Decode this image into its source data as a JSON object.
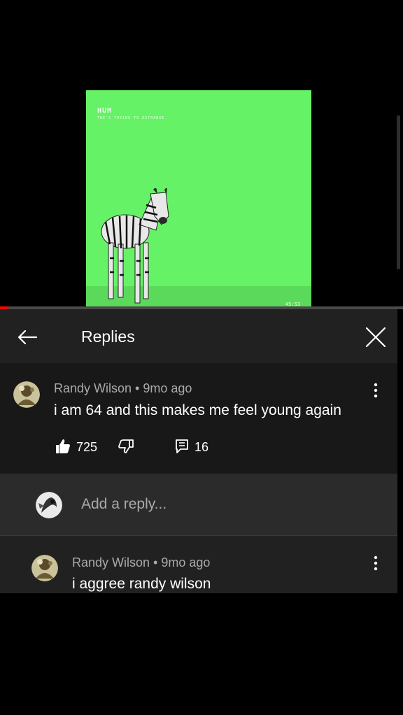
{
  "video": {
    "title": "HUM",
    "subtitle": "THE'S TRYING TO ESTRANGE",
    "timestamp": "45:53",
    "progress_fraction": 0.02
  },
  "replies_panel": {
    "title": "Replies",
    "back_icon": "arrow-left-icon",
    "close_icon": "close-icon"
  },
  "comment": {
    "author": "Randy Wilson",
    "separator": "•",
    "age": "9mo ago",
    "meta": "Randy Wilson • 9mo ago",
    "text": "i am 64 and this makes me feel young again",
    "likes": "725",
    "reply_count": "16"
  },
  "add_reply": {
    "placeholder": "Add a reply..."
  },
  "reply": {
    "meta": "Randy Wilson • 9mo ago",
    "text": "i aggree randy wilson"
  },
  "colors": {
    "panel_bg": "#212121",
    "comment_bg": "#181818",
    "add_reply_bg": "#2b2b2b",
    "meta_text": "#aaaaaa",
    "video_green": "#66f266"
  }
}
